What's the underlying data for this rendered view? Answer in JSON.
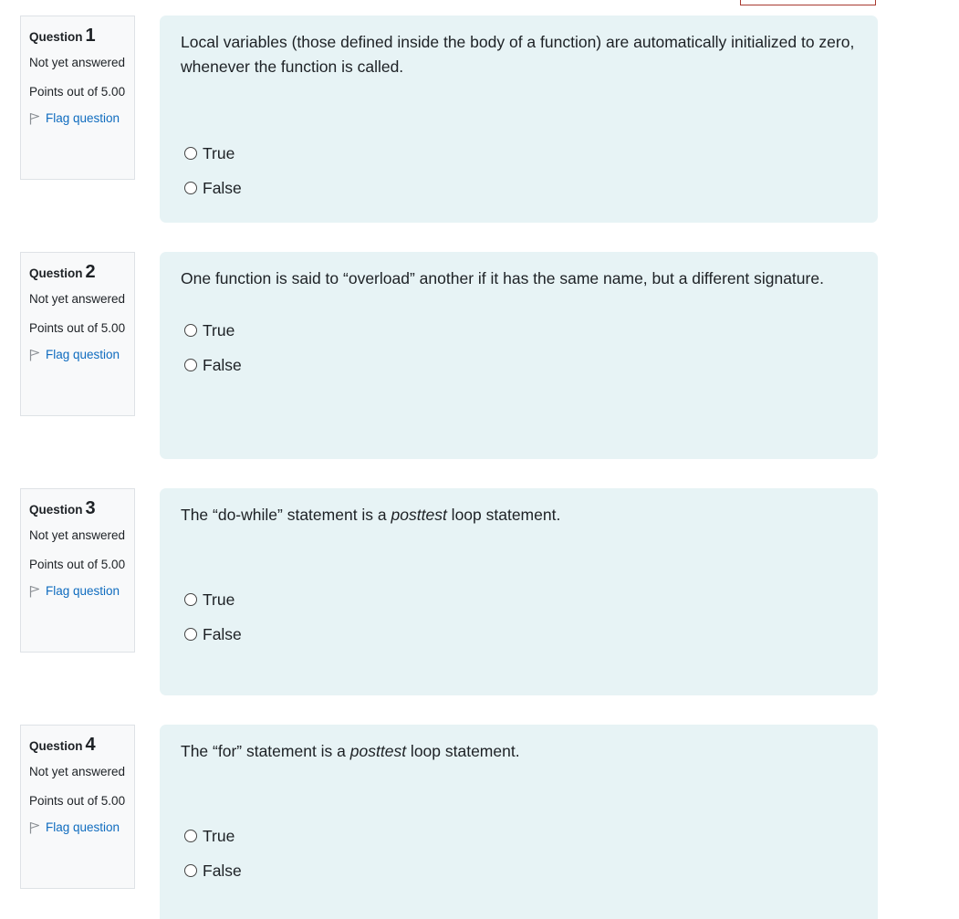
{
  "questions": [
    {
      "label": "Question",
      "number": "1",
      "state": "Not yet answered",
      "grade": "Points out of 5.00",
      "flag_label": "Flag question",
      "text_parts": [
        "Local variables (those defined inside the body of a function) are automatically initialized to zero, whenever the function is called."
      ],
      "options": [
        "True",
        "False"
      ]
    },
    {
      "label": "Question",
      "number": "2",
      "state": "Not yet answered",
      "grade": "Points out of 5.00",
      "flag_label": "Flag question",
      "text_parts": [
        "One function is said to “overload” another if it has the same name, but a different signature."
      ],
      "options": [
        "True",
        "False"
      ]
    },
    {
      "label": "Question",
      "number": "3",
      "state": "Not yet answered",
      "grade": "Points out of 5.00",
      "flag_label": "Flag question",
      "text_parts": [
        "The “do-while” statement is a ",
        "posttest",
        " loop statement."
      ],
      "options": [
        "True",
        "False"
      ]
    },
    {
      "label": "Question",
      "number": "4",
      "state": "Not yet answered",
      "grade": "Points out of 5.00",
      "flag_label": "Flag question",
      "text_parts": [
        "The “for” statement is a ",
        "posttest",
        " loop statement."
      ],
      "options": [
        "True",
        "False"
      ]
    }
  ],
  "colors": {
    "info_bg": "#f8f9fa",
    "content_bg": "#e7f3f5",
    "link": "#0f6cbf"
  }
}
